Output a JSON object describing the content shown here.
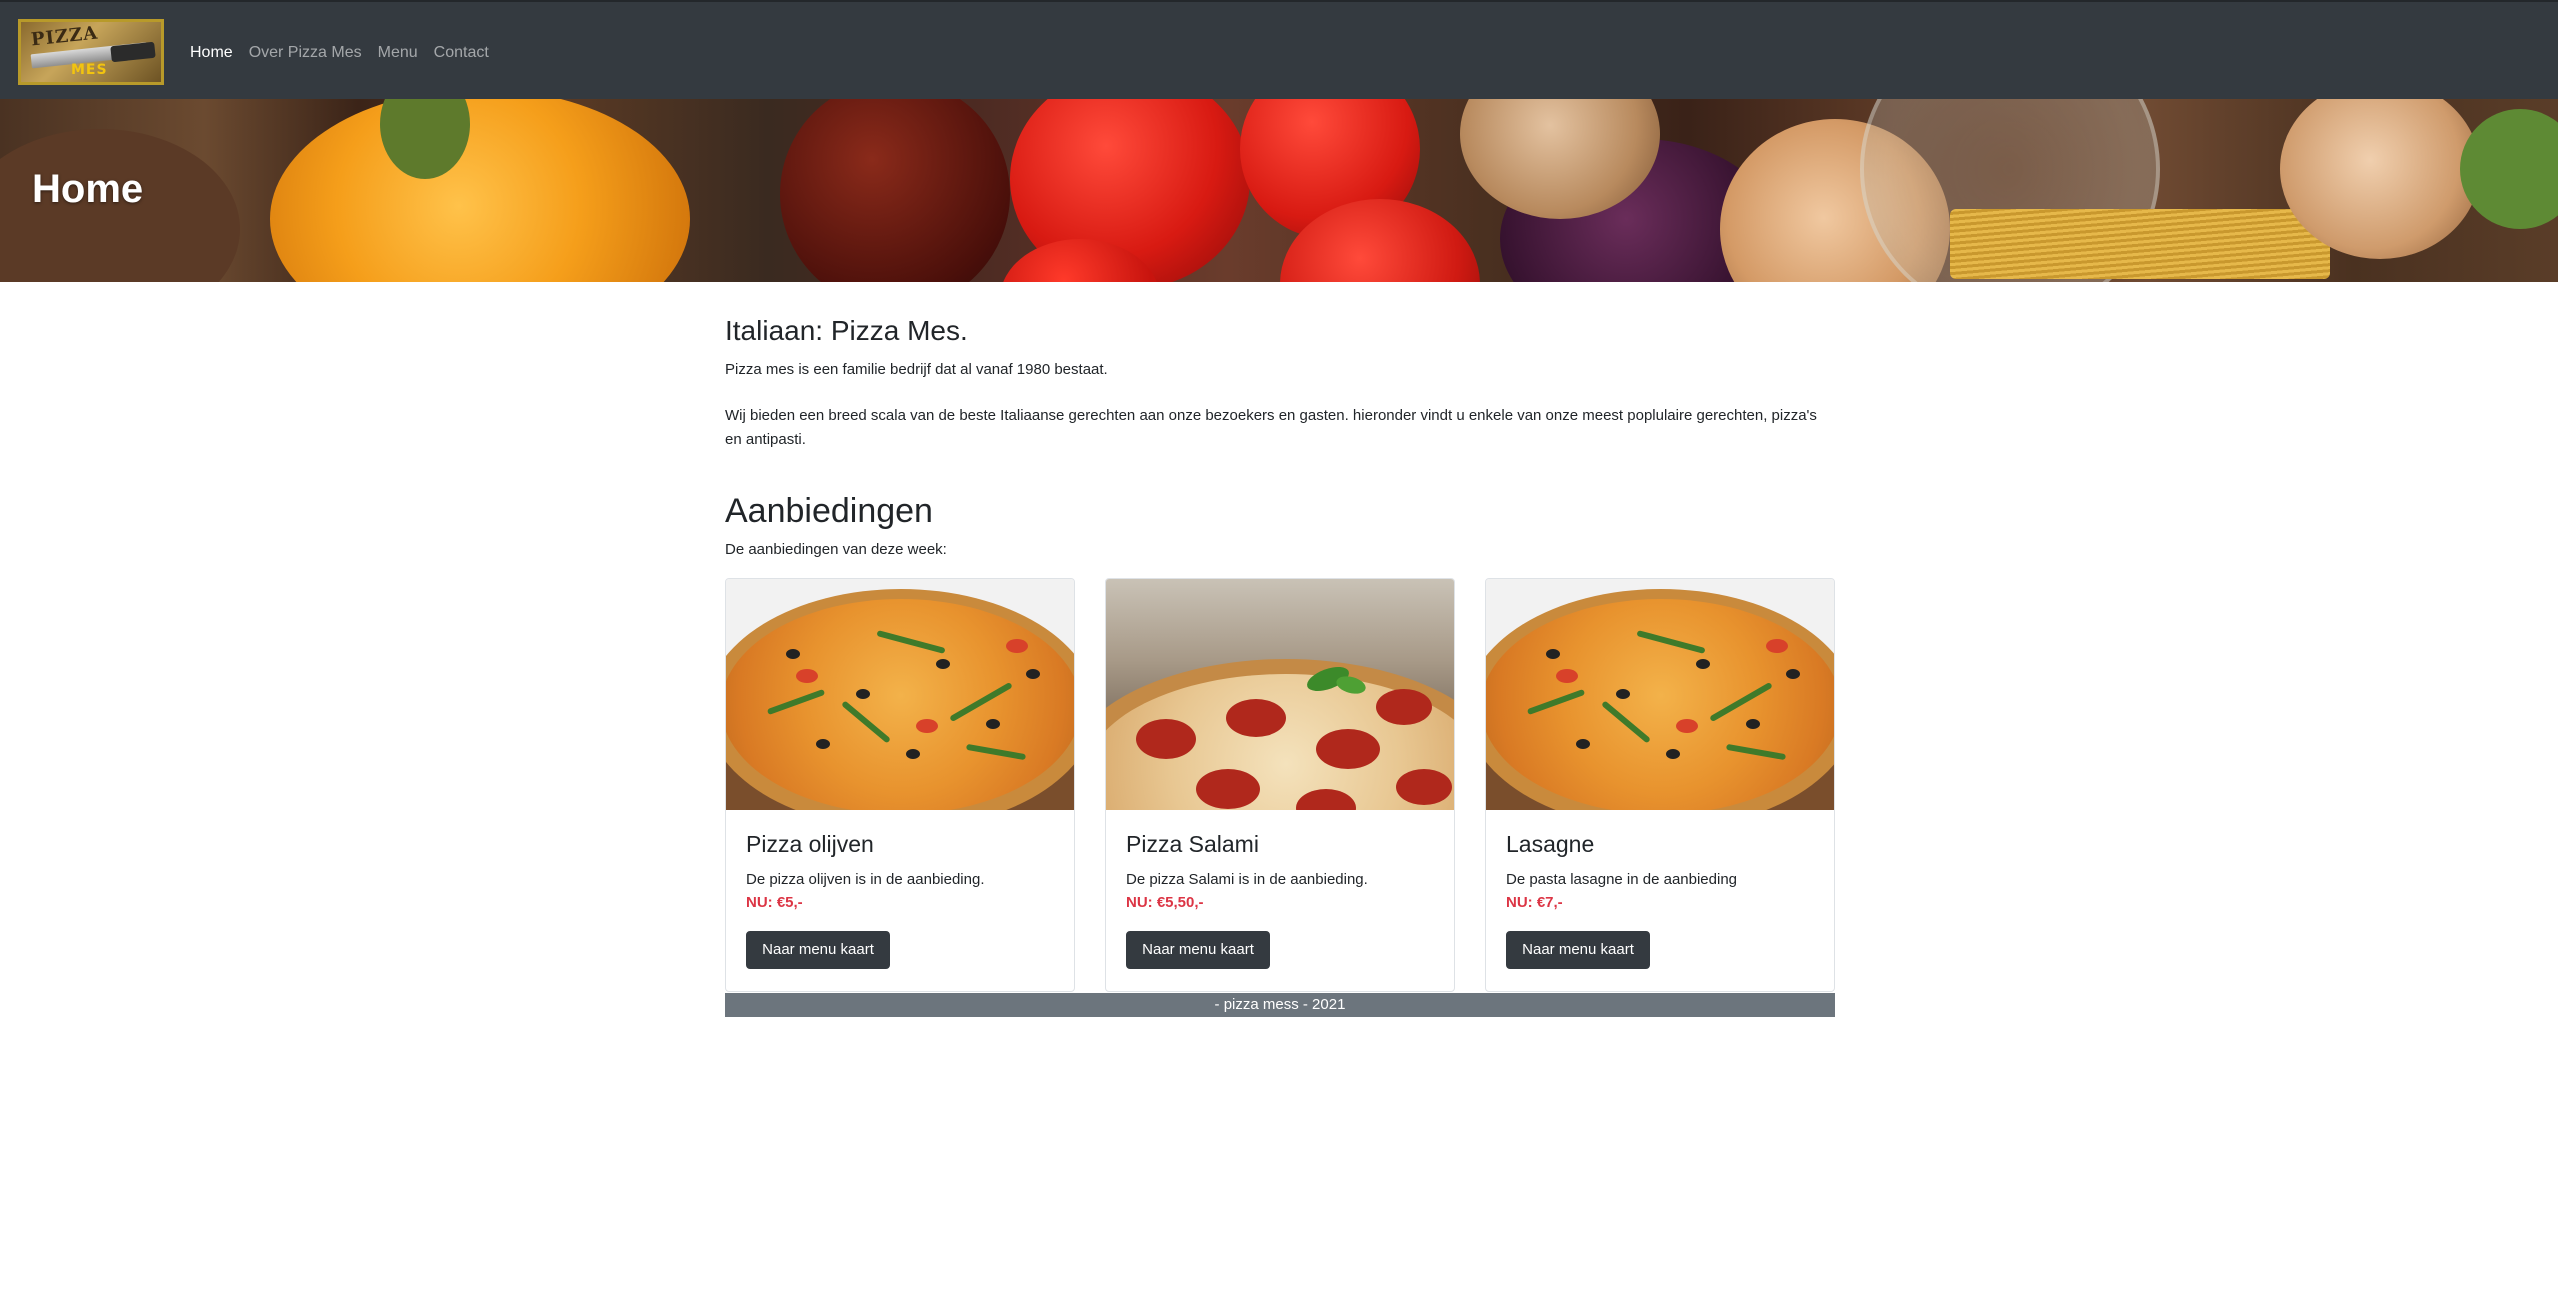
{
  "navbar": {
    "logo_text_top": "PIZZA",
    "logo_text_bottom": "MES",
    "items": [
      {
        "label": "Home",
        "active": true
      },
      {
        "label": "Over Pizza Mes",
        "active": false
      },
      {
        "label": "Menu",
        "active": false
      },
      {
        "label": "Contact",
        "active": false
      }
    ]
  },
  "hero": {
    "title": "Home"
  },
  "about": {
    "title": "Italiaan: Pizza Mes.",
    "paragraph1": "Pizza mes is een familie bedrijf dat al vanaf 1980 bestaat.",
    "paragraph2": "Wij bieden een breed scala van de beste Italiaanse gerechten aan onze bezoekers en gasten. hieronder vindt u enkele van onze meest poplulaire gerechten, pizza's en antipasti."
  },
  "offers": {
    "title": "Aanbiedingen",
    "subtitle": "De aanbiedingen van deze week:",
    "cards": [
      {
        "title": "Pizza olijven",
        "description": "De pizza olijven is in de aanbieding.",
        "price": "NU: €5,-",
        "button": "Naar menu kaart",
        "image": "pizza-olives-icon"
      },
      {
        "title": "Pizza Salami",
        "description": "De pizza Salami is in de aanbieding.",
        "price": "NU: €5,50,-",
        "button": "Naar menu kaart",
        "image": "pizza-salami-icon"
      },
      {
        "title": "Lasagne",
        "description": "De pasta lasagne in de aanbieding",
        "price": "NU: €7,-",
        "button": "Naar menu kaart",
        "image": "pizza-olives-icon"
      }
    ]
  },
  "footer": {
    "text": "- pizza mess - 2021"
  },
  "colors": {
    "navbar": "#343a40",
    "button": "#343a40",
    "price": "#dc3545",
    "footer": "#6c757d"
  }
}
